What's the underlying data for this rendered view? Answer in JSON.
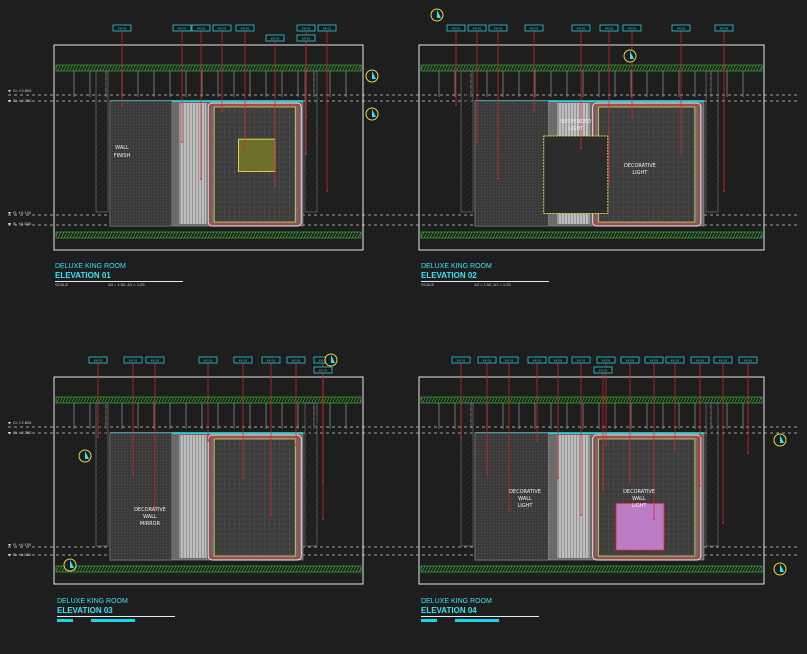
{
  "colors": {
    "background": "#1e1e1e",
    "frame": "#e6e6e6",
    "cyan": "#2ee6f2",
    "red": "#e0242f",
    "yellow": "#e6d84a",
    "green": "#3fbf3a",
    "wall_fill": "#6b6b6b",
    "magenta_panel": "#b97cc5",
    "level_line": "#cfcfcf",
    "tag_fill": "#1a1a1a"
  },
  "drawings": [
    {
      "id": "elevation-01",
      "room_label": "DELUXE KING ROOM",
      "elevation_label": "ELEVATION 01",
      "scale_label": "SCALE",
      "scale_value": "A3 = 1:50, A1 = 1:25",
      "tags": [
        "XX-01",
        "XX-01",
        "XX-01",
        "XX-01",
        "XX-01",
        "XX-01",
        "XX-01",
        "XX-01",
        "XX-01"
      ],
      "annotations": [
        {
          "text": "WALL",
          "role": "text-note"
        },
        {
          "text": "FINISH",
          "role": "text-note"
        }
      ]
    },
    {
      "id": "elevation-02",
      "room_label": "DELUXE KING ROOM",
      "elevation_label": "ELEVATION 02",
      "scale_label": "SCALE",
      "scale_value": "A3 = 1:50, A1 = 1:25",
      "tags": [
        "XX-01",
        "XX-01",
        "XX-01",
        "XX-01",
        "XX-01",
        "XX-01",
        "XX-01",
        "XX-01",
        "XX-01"
      ],
      "annotations": [
        {
          "text": "SUSPENDED",
          "role": "text-note"
        },
        {
          "text": "LIGHT",
          "role": "text-note"
        },
        {
          "text": "DECORATIVE",
          "role": "text-note"
        },
        {
          "text": "LIGHT",
          "role": "text-note"
        }
      ]
    },
    {
      "id": "elevation-03",
      "room_label": "DELUXE KING ROOM",
      "elevation_label": "ELEVATION 03",
      "tags": [
        "XX-01",
        "XX-01",
        "XX-01",
        "XX-01",
        "XX-01",
        "XX-01",
        "XX-01",
        "XX-01",
        "XX-01"
      ],
      "annotations": [
        {
          "text": "DECORATIVE",
          "role": "text-note"
        },
        {
          "text": "WALL",
          "role": "text-note"
        },
        {
          "text": "MIRROR",
          "role": "text-note"
        }
      ]
    },
    {
      "id": "elevation-04",
      "room_label": "DELUXE KING ROOM",
      "elevation_label": "ELEVATION 04",
      "tags": [
        "XX-01",
        "XX-01",
        "XX-01",
        "XX-01",
        "XX-01",
        "XX-01",
        "XX-01",
        "XX-01",
        "XX-01",
        "XX-01",
        "XX-01",
        "XX-01",
        "XX-01",
        "XX-01"
      ],
      "annotations": [
        {
          "text": "DECORATIVE",
          "role": "text-note"
        },
        {
          "text": "WALL",
          "role": "text-note"
        },
        {
          "text": "LIGHT",
          "role": "text-note"
        },
        {
          "text": "DECORATIVE",
          "role": "text-note"
        },
        {
          "text": "WALL",
          "role": "text-note"
        },
        {
          "text": "LIGHT",
          "role": "text-note"
        }
      ]
    }
  ],
  "level_markers": [
    "CL +2.850",
    "CL +2.700",
    "FL +0.150",
    "FL +0.000"
  ]
}
